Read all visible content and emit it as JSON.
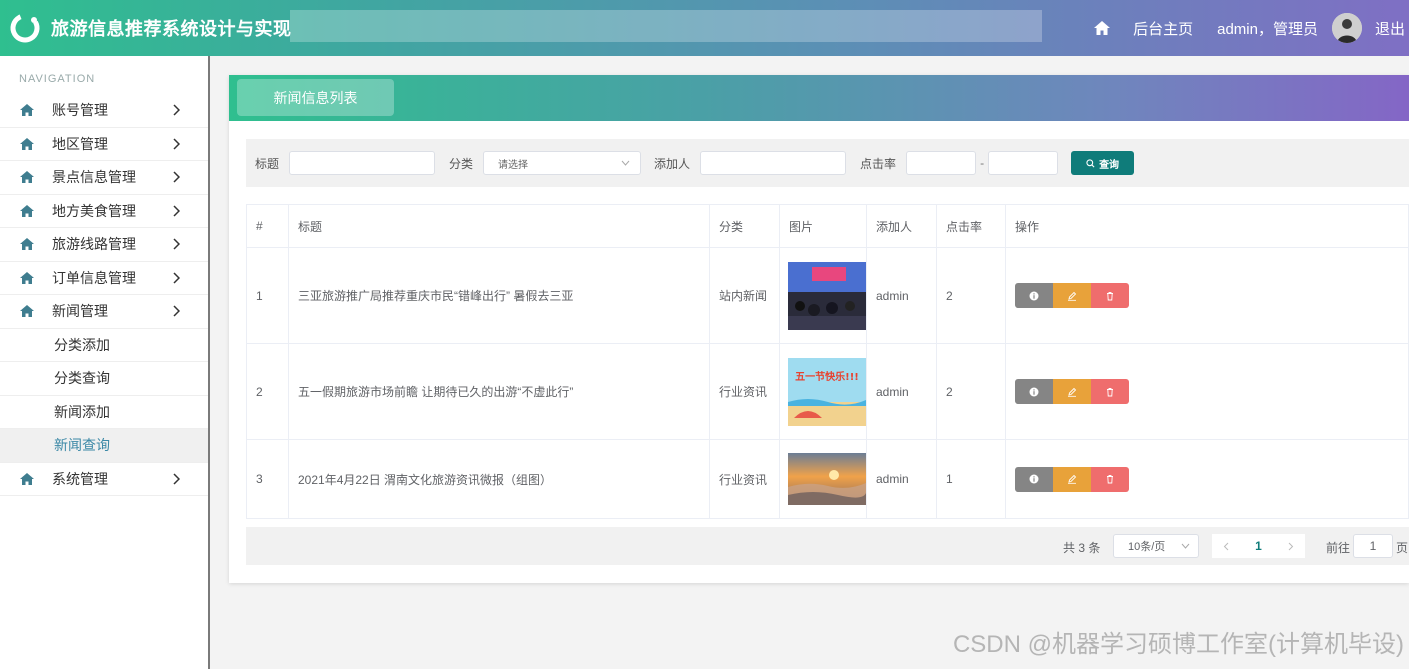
{
  "header": {
    "title": "旅游信息推荐系统设计与实现",
    "home_link": "后台主页",
    "user": "admin，管理员",
    "logout": "退出"
  },
  "sidebar": {
    "heading": "NAVIGATION",
    "items": [
      {
        "label": "账号管理"
      },
      {
        "label": "地区管理"
      },
      {
        "label": "景点信息管理"
      },
      {
        "label": "地方美食管理"
      },
      {
        "label": "旅游线路管理"
      },
      {
        "label": "订单信息管理"
      },
      {
        "label": "新闻管理"
      }
    ],
    "sub_items": [
      {
        "label": "分类添加"
      },
      {
        "label": "分类查询"
      },
      {
        "label": "新闻添加"
      },
      {
        "label": "新闻查询"
      }
    ],
    "last_item": {
      "label": "系统管理"
    }
  },
  "card": {
    "tab_title": "新闻信息列表"
  },
  "filter": {
    "title_label": "标题",
    "category_label": "分类",
    "category_placeholder": "请选择",
    "adder_label": "添加人",
    "clicks_label": "点击率",
    "range_sep": "-",
    "query_button": "查询"
  },
  "table": {
    "headers": [
      "#",
      "标题",
      "分类",
      "图片",
      "添加人",
      "点击率",
      "操作"
    ],
    "rows": [
      {
        "no": "1",
        "title": "三亚旅游推广局推荐重庆市民“错峰出行” 暑假去三亚",
        "category": "站内新闻",
        "adder": "admin",
        "clicks": "2",
        "image": "event-photo"
      },
      {
        "no": "2",
        "title": "五一假期旅游市场前瞻 让期待已久的出游“不虚此行”",
        "category": "行业资讯",
        "adder": "admin",
        "clicks": "2",
        "image": "beach-illustration"
      },
      {
        "no": "3",
        "title": "2021年4月22日 渭南文化旅游资讯微报（组图）",
        "category": "行业资讯",
        "adder": "admin",
        "clicks": "1",
        "image": "sunset-clouds"
      }
    ],
    "thumb2_text": "五一节快乐!!!"
  },
  "pagination": {
    "total": "共 3 条",
    "page_size": "10条/页",
    "current": "1",
    "goto_label": "前往",
    "goto_value": "1",
    "page_suffix": "页"
  },
  "watermark": "CSDN @机器学习硕博工作室(计算机毕设)",
  "colors": {
    "brand_green": "#2fbf8f",
    "brand_purple": "#7f6fc4",
    "query_button": "#0f7c7a",
    "info_button": "#858585",
    "edit_button": "#e8a23a",
    "delete_button": "#ef6d6d",
    "active_nav_text": "#3b88a6"
  }
}
